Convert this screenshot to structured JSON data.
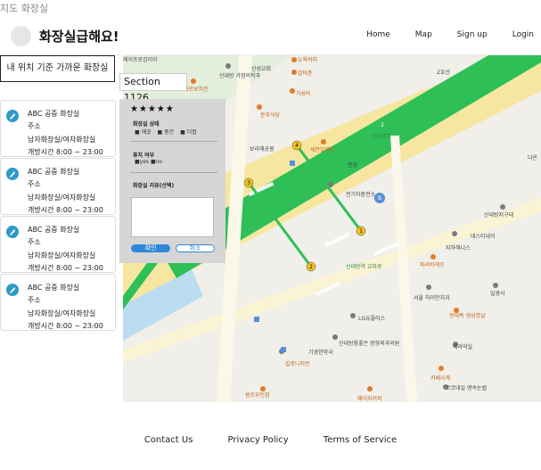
{
  "caption": "지도 화장실",
  "header": {
    "title": "화장실급해요!",
    "nav": [
      "Home",
      "Map",
      "Sign up",
      "Login"
    ]
  },
  "near_button": "내 위치 기준 가까운 화장실",
  "toilets": [
    {
      "name": "ABC 공중 화장실",
      "address": "주소",
      "type": "남자화장실/여자화장실",
      "hours": "개방시간 8:00 ~ 23:00"
    },
    {
      "name": "ABC 공중 화장실",
      "address": "주소",
      "type": "남자화장실/여자화장실",
      "hours": "개방시간 8:00 ~ 23:00"
    },
    {
      "name": "ABC 공중 화장실",
      "address": "주소",
      "type": "남자화장실/여자화장실",
      "hours": "개방시간 8:00 ~ 23:00"
    },
    {
      "name": "ABC 공중 화장실",
      "address": "주소",
      "type": "남자화장실/여자화장실",
      "hours": "개방시간 8:00 ~ 23:00"
    }
  ],
  "section": "Section 1126",
  "review": {
    "stars": "★★★★★",
    "status_title": "화장실 상태",
    "status_options": [
      "■ 깨끗",
      "■ 중간",
      "■ 더럽"
    ],
    "tissue_title": "휴지 여부",
    "tissue_options": [
      "■yes ■no"
    ],
    "review_title": "화장실 리뷰(선택)",
    "ok": "확인",
    "cancel": "취소"
  },
  "map": {
    "labels": [
      {
        "text": "에이프로갑이이",
        "c": ""
      },
      {
        "text": "뉴욕커피",
        "c": "orange"
      },
      {
        "text": "신성교회",
        "c": ""
      },
      {
        "text": "갈비촌",
        "c": "orange"
      },
      {
        "text": "가성비",
        "c": "orange"
      },
      {
        "text": "신대방 가정의학과",
        "c": ""
      },
      {
        "text": "카르보치킨",
        "c": "orange"
      },
      {
        "text": "문추식당",
        "c": "orange"
      },
      {
        "text": "2호선",
        "c": ""
      },
      {
        "text": "신대방역",
        "c": "green"
      },
      {
        "text": "세븐일레븐",
        "c": "orange"
      },
      {
        "text": "관광",
        "c": ""
      },
      {
        "text": "전기자충전소",
        "c": ""
      },
      {
        "text": "보라매공원",
        "c": ""
      },
      {
        "text": "신대방역 교차로",
        "c": "green"
      },
      {
        "text": "파리바게뜨",
        "c": "orange"
      },
      {
        "text": "지하해니스",
        "c": ""
      },
      {
        "text": "데스티네이",
        "c": ""
      },
      {
        "text": "서울 하이안치과",
        "c": ""
      },
      {
        "text": "일광사",
        "c": ""
      },
      {
        "text": "LG유플러스",
        "c": ""
      },
      {
        "text": "왕대폭 생성겸살",
        "c": "orange"
      },
      {
        "text": "신대방참좋은 정형외과의원",
        "c": ""
      },
      {
        "text": "기경한약국",
        "c": ""
      },
      {
        "text": "킬로니지언",
        "c": "orange"
      },
      {
        "text": "메라약실",
        "c": ""
      },
      {
        "text": "카페사계",
        "c": "orange"
      },
      {
        "text": "코코네일 엔속눈썹",
        "c": ""
      },
      {
        "text": "원조부인집",
        "c": "orange"
      },
      {
        "text": "메이지커피",
        "c": "orange"
      },
      {
        "text": "신대방지구대",
        "c": ""
      },
      {
        "text": "다온",
        "c": ""
      }
    ]
  }
}
